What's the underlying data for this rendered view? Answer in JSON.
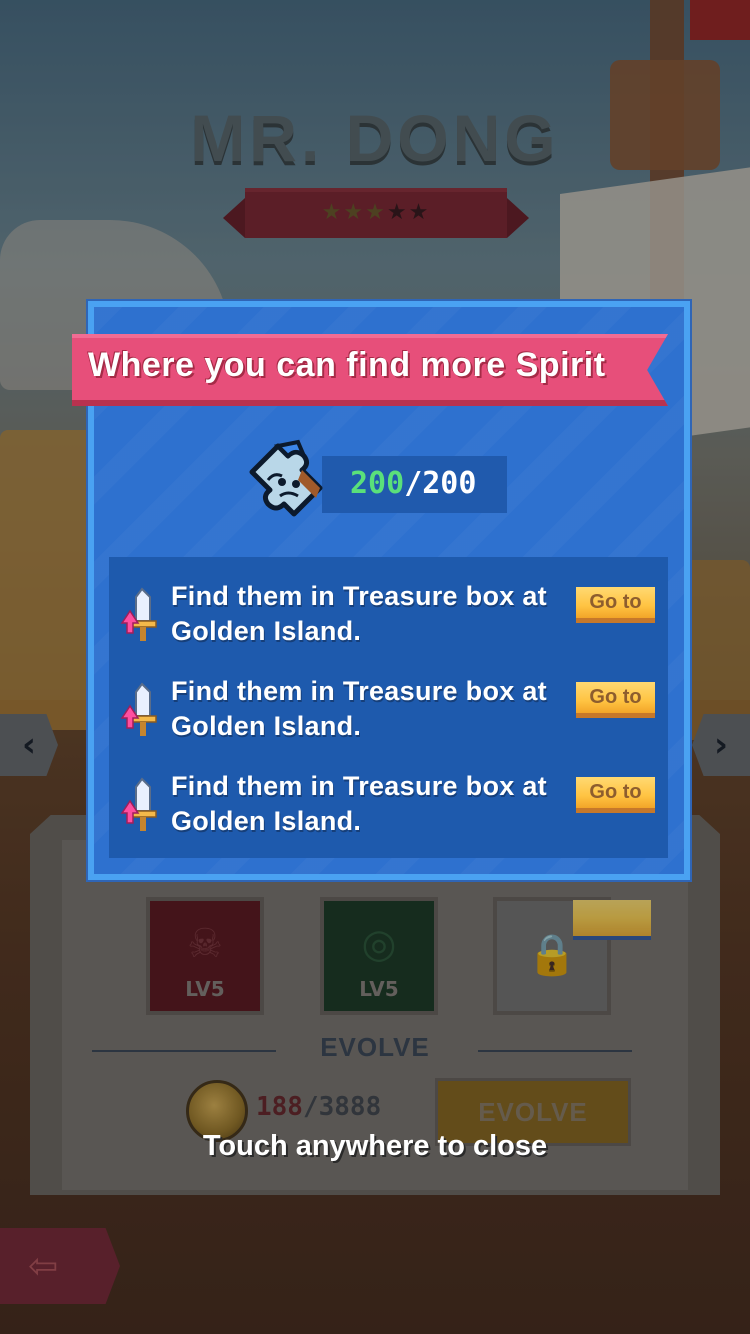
{
  "hero": {
    "name": "MR. DONG",
    "stars_filled": 3,
    "stars_total": 5
  },
  "nav": {
    "prev_icon": "chevron-left-icon",
    "next_icon": "chevron-right-icon",
    "back_icon": "back-arrow-icon"
  },
  "skills": [
    {
      "label": "LV5",
      "icon": "skull-icon",
      "color": "#5f1d24"
    },
    {
      "label": "LV5",
      "icon": "swirl-icon",
      "color": "#1f3d2a"
    },
    {
      "label": "",
      "icon": "lock-icon",
      "color": "#777777"
    }
  ],
  "evolve": {
    "heading": "EVOLVE",
    "cost_have": "188",
    "cost_separator": "/",
    "cost_need": "3888",
    "button_label": "EVOLVE"
  },
  "popup": {
    "title": "Where you can find more Spirit",
    "spirit_current": "200",
    "spirit_separator": "/",
    "spirit_max": "200",
    "rows": [
      {
        "text": "Find them in Treasure box at Golden Island.",
        "button": "Go to"
      },
      {
        "text": "Find them in Treasure box at Golden Island.",
        "button": "Go to"
      },
      {
        "text": "Find them in Treasure box at Golden Island.",
        "button": "Go to"
      }
    ]
  },
  "hint": "Touch anywhere to close",
  "colors": {
    "popup_bg": "#2e71cf",
    "banner": "#e74f7a",
    "spirit_green": "#5ae07a",
    "goto_yellow": "#ffc443"
  }
}
